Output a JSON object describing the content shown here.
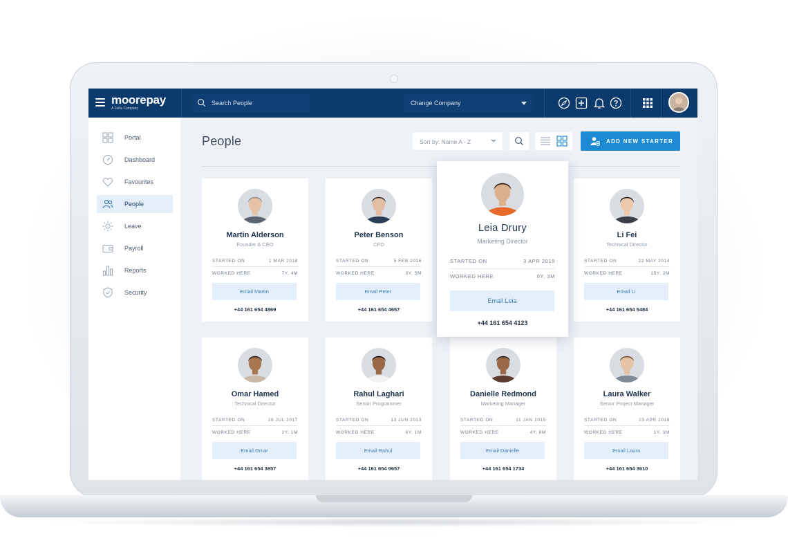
{
  "app": {
    "logo": "moorepay",
    "logo_sub": "A Zellis Company"
  },
  "topbar": {
    "search_placeholder": "Search People",
    "company_select": "Change Company",
    "icons": [
      "compass-icon",
      "plus-square-icon",
      "bell-icon",
      "help-icon",
      "apps-grid-icon",
      "user-avatar"
    ]
  },
  "sidebar": {
    "items": [
      {
        "label": "Portal",
        "icon": "grid-icon",
        "active": false
      },
      {
        "label": "Dashboard",
        "icon": "gauge-icon",
        "active": false
      },
      {
        "label": "Favourites",
        "icon": "heart-icon",
        "active": false
      },
      {
        "label": "People",
        "icon": "people-icon",
        "active": true
      },
      {
        "label": "Leave",
        "icon": "sun-icon",
        "active": false
      },
      {
        "label": "Payroll",
        "icon": "wallet-icon",
        "active": false
      },
      {
        "label": "Reports",
        "icon": "bar-chart-icon",
        "active": false
      },
      {
        "label": "Security",
        "icon": "shield-icon",
        "active": false
      }
    ]
  },
  "main": {
    "title": "People",
    "sort_label": "Sort by: Name A - Z",
    "add_button": "ADD NEW STARTER",
    "started_label": "STARTED ON",
    "worked_label": "WORKED HERE"
  },
  "people": [
    {
      "name": "Martin Alderson",
      "role": "Founder & CEO",
      "started": "1 MAR 2018",
      "worked": "7Y, 4M",
      "email_label": "Email Martin",
      "phone": "+44 161 654 4869",
      "skin": "#e6c2a6",
      "hair": "#8e8a86",
      "shirt": "#5b6470"
    },
    {
      "name": "Peter Benson",
      "role": "CFO",
      "started": "5 FEB 2016",
      "worked": "3Y, 5M",
      "email_label": "Email Peter",
      "phone": "+44 161 654 4657",
      "skin": "#e3bea2",
      "hair": "#3a2f28",
      "shirt": "#2c3e55"
    },
    {
      "name": "Leia Drury",
      "role": "Marketing Director",
      "started": "3 APR 2019",
      "worked": "0Y, 3M",
      "email_label": "Email Leia",
      "phone": "+44 161 654 4123",
      "skin": "#dcb08c",
      "hair": "#3b2618",
      "shirt": "#e86a2a"
    },
    {
      "name": "Li Fei",
      "role": "Technical Director",
      "started": "22 MAY 2014",
      "worked": "15Y, 2M",
      "email_label": "Email Li",
      "phone": "+44 161 654 5484",
      "skin": "#ecc9ad",
      "hair": "#1d1a19",
      "shirt": "#3b3f47"
    },
    {
      "name": "Omar Hamed",
      "role": "Technical Director",
      "started": "28 JUL 2017",
      "worked": "2Y, 1M",
      "email_label": "Email Omar",
      "phone": "+44 161 654 3657",
      "skin": "#a8764f",
      "hair": "#2b1d14",
      "shirt": "#c7b9a3"
    },
    {
      "name": "Rahul Laghari",
      "role": "Senior Programmer",
      "started": "13 JUN 2013",
      "worked": "6Y, 1M",
      "email_label": "Email Rahul",
      "phone": "+44 161 654 9657",
      "skin": "#9a6a46",
      "hair": "#1b1410",
      "shirt": "#f2f2f2"
    },
    {
      "name": "Danielle Redmond",
      "role": "Marketing Manager",
      "started": "11 JAN 2015",
      "worked": "4Y, 6M",
      "email_label": "Email Danielle",
      "phone": "+44 161 654 1734",
      "skin": "#9b6a48",
      "hair": "#2a1c14",
      "shirt": "#5a3b2c"
    },
    {
      "name": "Laura Walker",
      "role": "Senior Project Manager",
      "started": "23 APR 2018",
      "worked": "1Y, 3M",
      "email_label": "Email Laura",
      "phone": "+44 161 654 3610",
      "skin": "#e7c3a6",
      "hair": "#6a4a33",
      "shirt": "#7c8a96"
    }
  ],
  "colors": {
    "brand_navy": "#0c3a6d",
    "accent_blue": "#1b8ad3",
    "email_bg": "#e2eef9"
  }
}
